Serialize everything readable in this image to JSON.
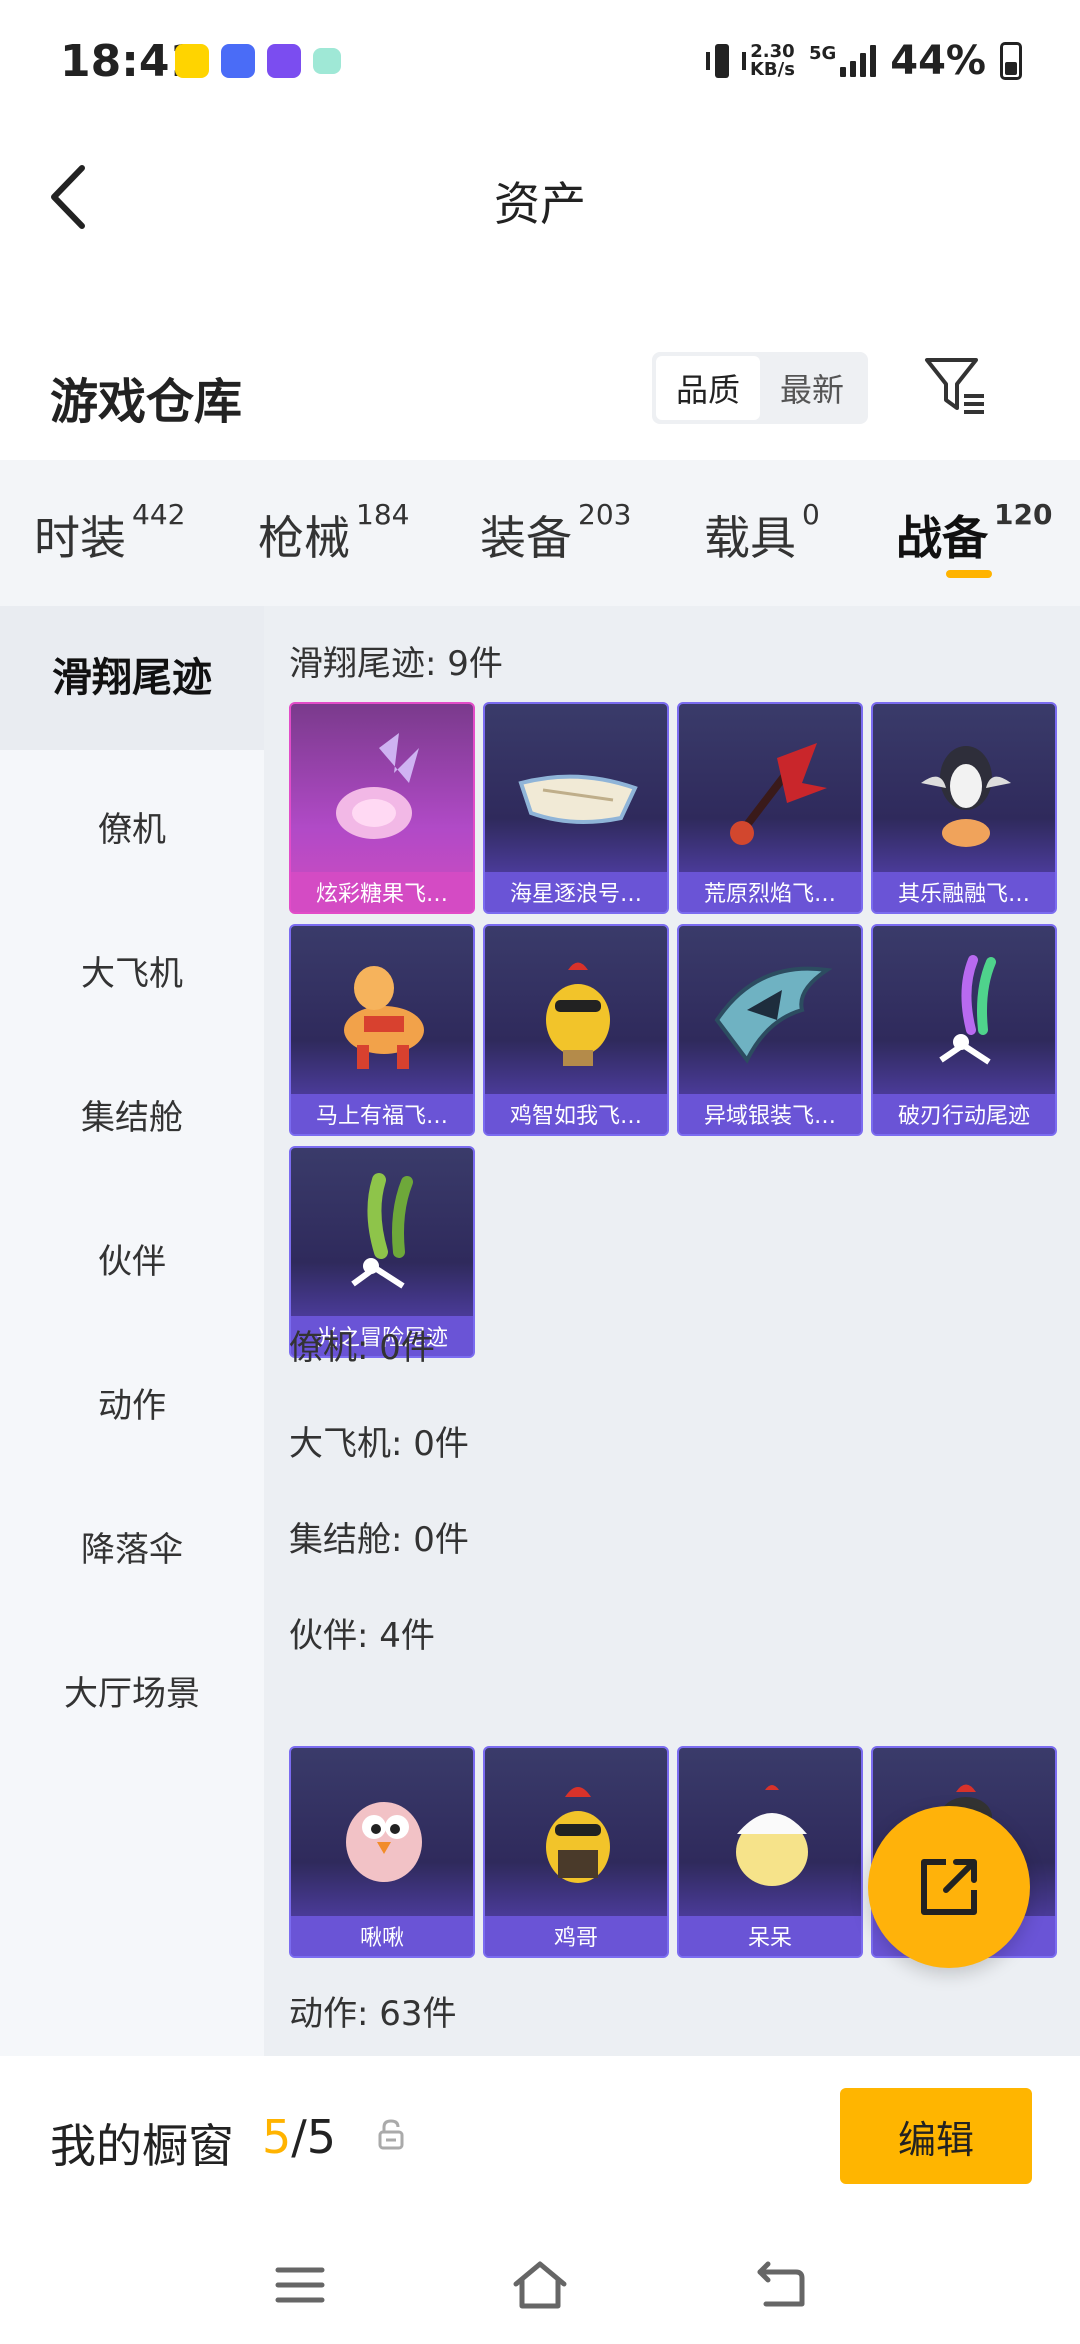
{
  "status_bar": {
    "time": "18:41",
    "speed_value": "2.30",
    "speed_unit": "KB/s",
    "network": "5G",
    "battery": "44%"
  },
  "header": {
    "title": "资产"
  },
  "warehouse": {
    "title": "游戏仓库",
    "sort_options": [
      "品质",
      "最新"
    ],
    "sort_selected": "品质"
  },
  "tabs": [
    {
      "label": "时装",
      "count": "442"
    },
    {
      "label": "枪械",
      "count": "184"
    },
    {
      "label": "装备",
      "count": "203"
    },
    {
      "label": "载具",
      "count": "0"
    },
    {
      "label": "战备",
      "count": "120"
    }
  ],
  "active_tab": "战备",
  "sidebar": {
    "items": [
      "滑翔尾迹",
      "僚机",
      "大飞机",
      "集结舱",
      "伙伴",
      "动作",
      "降落伞",
      "大厅场景"
    ]
  },
  "sections": {
    "glide": {
      "label": "滑翔尾迹: 9件",
      "items": [
        "炫彩糖果飞…",
        "海星逐浪号…",
        "荒原烈焰飞…",
        "其乐融融飞…",
        "马上有福飞…",
        "鸡智如我飞…",
        "异域银装飞…",
        "破刃行动尾迹",
        "光之冒险尾迹"
      ]
    },
    "wingman": {
      "label": "僚机: 0件"
    },
    "plane": {
      "label": "大飞机: 0件"
    },
    "pod": {
      "label": "集结舱: 0件"
    },
    "partner": {
      "label": "伙伴: 4件",
      "items": [
        "啾啾",
        "鸡哥",
        "呆呆",
        ""
      ]
    },
    "emote": {
      "label": "动作: 63件"
    }
  },
  "showcase": {
    "title": "我的橱窗",
    "current": "5",
    "separator": "/",
    "total": "5",
    "edit_label": "编辑"
  },
  "colors": {
    "accent": "#ffb300",
    "card": "#5e47c4",
    "card_highlight": "#d04cbf"
  }
}
